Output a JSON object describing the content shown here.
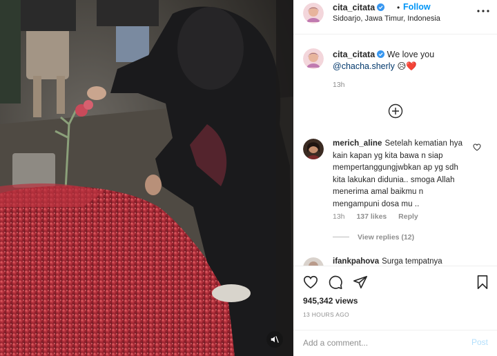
{
  "post": {
    "username": "cita_citata",
    "follow_label": "Follow",
    "dot": "•",
    "location": "Sidoarjo, Jawa Timur, Indonesia"
  },
  "caption": {
    "username": "cita_citata",
    "text": "We love you",
    "mention": "@chacha.sherly",
    "emoji": "😥❤️",
    "time": "13h"
  },
  "comments": [
    {
      "username": "merich_aline",
      "text": "Setelah kematian hya kain kapan yg kita bawa n siap mempertanggungjwbkan ap yg sdh kita lakukan didunia.. smoga Allah menerima amal baikmu n mengampuni dosa mu ..",
      "time": "13h",
      "likes": "137 likes",
      "reply_label": "Reply",
      "view_replies": "View replies (12)"
    },
    {
      "username": "ifankpahova",
      "text": "Surga tempatnya"
    }
  ],
  "stats": {
    "views": "945,342 views",
    "time_ago": "13 HOURS AGO"
  },
  "composer": {
    "placeholder": "Add a comment...",
    "post_label": "Post"
  },
  "icons": {
    "more": "more-icon",
    "verified": "verified-badge-icon",
    "load_more": "plus-circle-icon",
    "like": "heart-icon",
    "comment": "comment-icon",
    "share": "share-icon",
    "save": "bookmark-icon",
    "mute": "muted-speaker-icon"
  },
  "colors": {
    "link_blue": "#0095f6",
    "mention_blue": "#00376b",
    "muted_gray": "#8e8e8e",
    "post_disabled": "#b2dffc"
  }
}
